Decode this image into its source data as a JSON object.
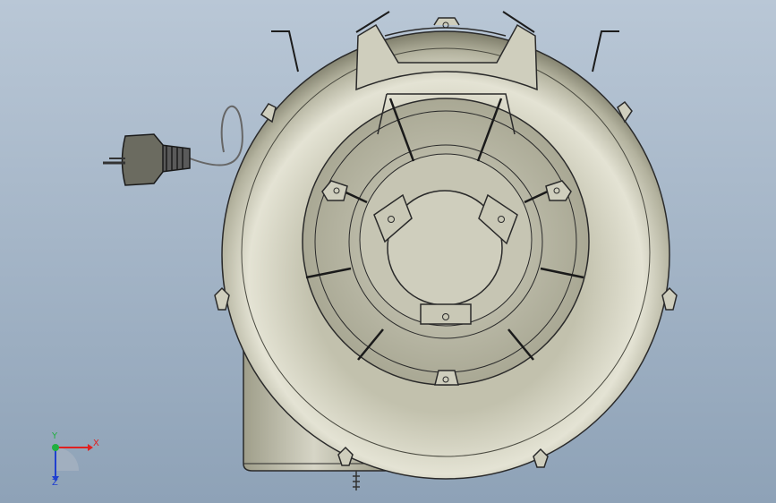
{
  "viewport": {
    "background_top": "#b9c7d6",
    "background_bottom": "#8ea2b7",
    "model_fill": "#c9c8b6",
    "model_shadow": "#8c8b78",
    "edge_color": "#2a2a2a"
  },
  "triad": {
    "x_label": "X",
    "y_label": "Y",
    "z_label": "Z",
    "x_color": "#e02020",
    "y_color": "#20b040",
    "z_color": "#2040d0"
  }
}
